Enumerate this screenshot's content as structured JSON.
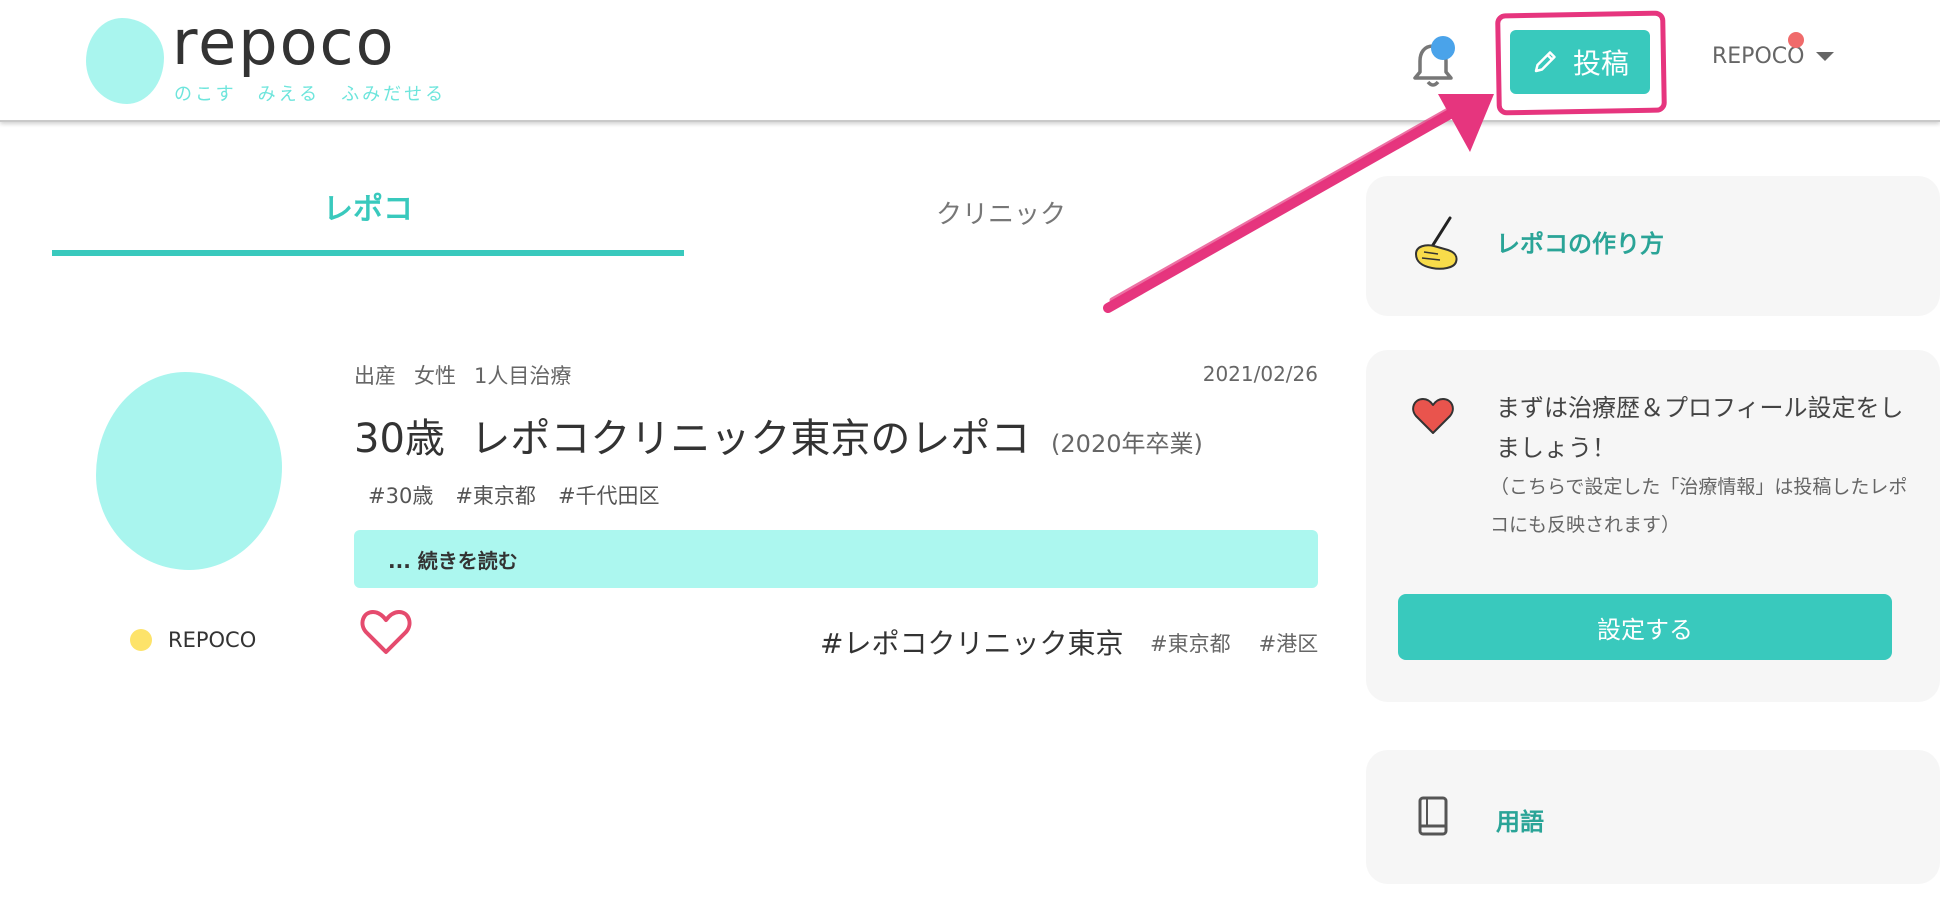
{
  "header": {
    "logo_word": "repoco",
    "logo_tagline": "のこす　みえる　ふみだせる",
    "post_button_label": "投稿",
    "user_name": "REPOCO"
  },
  "tabs": [
    {
      "label": "レポコ",
      "active": true
    },
    {
      "label": "クリニック",
      "active": false
    }
  ],
  "post": {
    "author": "REPOCO",
    "meta": [
      "出産",
      "女性",
      "1人目治療"
    ],
    "date": "2021/02/26",
    "title": "30歳  レポコクリニック東京のレポコ",
    "graduation": "(2020年卒業)",
    "tags": [
      "#30歳",
      "#東京都",
      "#千代田区"
    ],
    "read_more": "... 続きを読む",
    "clinic_tag": "#レポコクリニック東京",
    "location_tags": [
      "#東京都",
      "#港区"
    ]
  },
  "sidebar": {
    "howto_label": "レポコの作り方",
    "setup_main": "まずは治療歴＆プロフィール設定をしましょう！",
    "setup_sub": "（こちらで設定した「治療情報」は投稿したレポコにも反映されます）",
    "setup_button": "設定する",
    "glossary_label": "用語"
  },
  "colors": {
    "accent": "#39c9bd",
    "accent_light": "#acf7ef",
    "annotation": "#e6357e",
    "notification_dot": "#4aa3ea",
    "user_dot": "#f06b6b",
    "author_dot": "#fde36a"
  },
  "icons": [
    "bell-icon",
    "pencil-icon",
    "hand-writing-icon",
    "heart-icon",
    "book-icon",
    "caret-down-icon",
    "like-heart-icon"
  ]
}
